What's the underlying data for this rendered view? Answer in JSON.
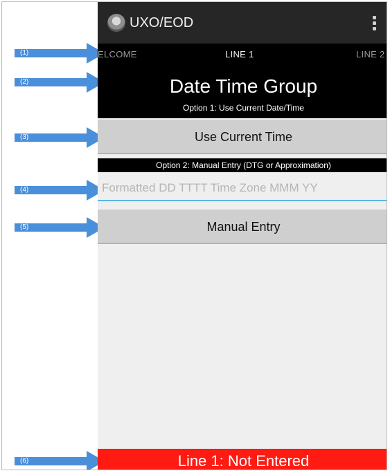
{
  "callouts": [
    "(1)",
    "(2)",
    "(3)",
    "(4)",
    "(5)",
    "(6)"
  ],
  "app": {
    "title": "UXO/EOD",
    "overflow_icon": "vertical-dots-icon"
  },
  "tabs": {
    "welcome": "ELCOME",
    "line1": "LINE 1",
    "line2": "LINE 2"
  },
  "header": {
    "title": "Date Time Group",
    "option1": "Option 1: Use Current Date/Time"
  },
  "buttons": {
    "use_current": "Use Current Time",
    "manual": "Manual Entry"
  },
  "option2": "Option 2: Manual Entry (DTG or Approximation)",
  "dtg_input": {
    "value": "",
    "placeholder": "Formatted DD TTTT Time Zone MMM YY"
  },
  "status": "Line 1: Not Entered",
  "colors": {
    "status_red": "#ff1a12",
    "arrow_blue": "#4a8fd9",
    "input_underline": "#5bb7e5"
  }
}
